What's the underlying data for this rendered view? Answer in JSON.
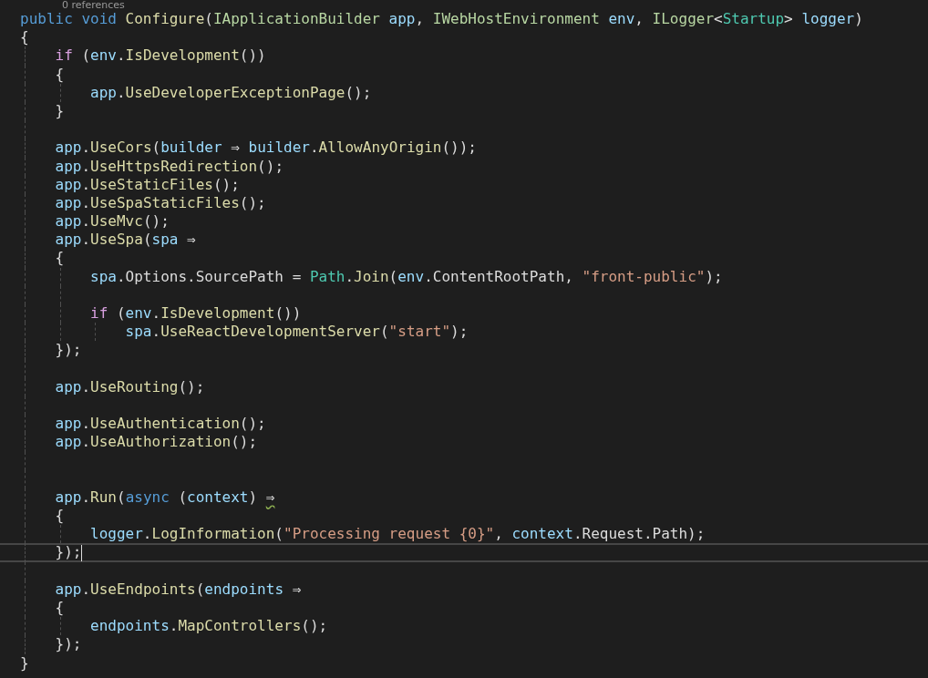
{
  "codelens": "0 references",
  "lines": [
    {
      "kind": "code",
      "tokens": [
        {
          "text": "public",
          "kind": "kw"
        },
        {
          "text": " void",
          "kind": "kw"
        },
        {
          "text": " Configure",
          "kind": "method"
        },
        {
          "text": "(",
          "kind": "plain"
        },
        {
          "text": "IApplicationBuilder",
          "kind": "iface"
        },
        {
          "text": " app",
          "kind": "var"
        },
        {
          "text": ", ",
          "kind": "plain"
        },
        {
          "text": "IWebHostEnvironment",
          "kind": "iface"
        },
        {
          "text": " env",
          "kind": "var"
        },
        {
          "text": ", ",
          "kind": "plain"
        },
        {
          "text": "ILogger",
          "kind": "iface"
        },
        {
          "text": "<",
          "kind": "plain"
        },
        {
          "text": "Startup",
          "kind": "type"
        },
        {
          "text": "> ",
          "kind": "plain"
        },
        {
          "text": "logger",
          "kind": "var"
        },
        {
          "text": ")",
          "kind": "plain"
        }
      ]
    },
    {
      "kind": "code",
      "tokens": [
        {
          "text": "{",
          "kind": "plain"
        }
      ]
    },
    {
      "kind": "code",
      "tokens": [
        {
          "text": "    if",
          "kind": "ctrl"
        },
        {
          "text": " (",
          "kind": "plain"
        },
        {
          "text": "env",
          "kind": "var"
        },
        {
          "text": ".",
          "kind": "plain"
        },
        {
          "text": "IsDevelopment",
          "kind": "method"
        },
        {
          "text": "())",
          "kind": "plain"
        }
      ]
    },
    {
      "kind": "code",
      "tokens": [
        {
          "text": "    {",
          "kind": "plain"
        }
      ]
    },
    {
      "kind": "code",
      "tokens": [
        {
          "text": "        app",
          "kind": "var"
        },
        {
          "text": ".",
          "kind": "plain"
        },
        {
          "text": "UseDeveloperExceptionPage",
          "kind": "method"
        },
        {
          "text": "();",
          "kind": "plain"
        }
      ]
    },
    {
      "kind": "code",
      "tokens": [
        {
          "text": "    }",
          "kind": "plain"
        }
      ]
    },
    {
      "kind": "blank"
    },
    {
      "kind": "code",
      "tokens": [
        {
          "text": "    app",
          "kind": "var"
        },
        {
          "text": ".",
          "kind": "plain"
        },
        {
          "text": "UseCors",
          "kind": "method"
        },
        {
          "text": "(",
          "kind": "plain"
        },
        {
          "text": "builder",
          "kind": "var"
        },
        {
          "text": " ⇒ ",
          "kind": "plain"
        },
        {
          "text": "builder",
          "kind": "var"
        },
        {
          "text": ".",
          "kind": "plain"
        },
        {
          "text": "AllowAnyOrigin",
          "kind": "method"
        },
        {
          "text": "());",
          "kind": "plain"
        }
      ]
    },
    {
      "kind": "code",
      "tokens": [
        {
          "text": "    app",
          "kind": "var"
        },
        {
          "text": ".",
          "kind": "plain"
        },
        {
          "text": "UseHttpsRedirection",
          "kind": "method"
        },
        {
          "text": "();",
          "kind": "plain"
        }
      ]
    },
    {
      "kind": "code",
      "tokens": [
        {
          "text": "    app",
          "kind": "var"
        },
        {
          "text": ".",
          "kind": "plain"
        },
        {
          "text": "UseStaticFiles",
          "kind": "method"
        },
        {
          "text": "();",
          "kind": "plain"
        }
      ]
    },
    {
      "kind": "code",
      "tokens": [
        {
          "text": "    app",
          "kind": "var"
        },
        {
          "text": ".",
          "kind": "plain"
        },
        {
          "text": "UseSpaStaticFiles",
          "kind": "method"
        },
        {
          "text": "();",
          "kind": "plain"
        }
      ]
    },
    {
      "kind": "code",
      "tokens": [
        {
          "text": "    app",
          "kind": "var"
        },
        {
          "text": ".",
          "kind": "plain"
        },
        {
          "text": "UseMvc",
          "kind": "method"
        },
        {
          "text": "();",
          "kind": "plain"
        }
      ]
    },
    {
      "kind": "code",
      "tokens": [
        {
          "text": "    app",
          "kind": "var"
        },
        {
          "text": ".",
          "kind": "plain"
        },
        {
          "text": "UseSpa",
          "kind": "method"
        },
        {
          "text": "(",
          "kind": "plain"
        },
        {
          "text": "spa",
          "kind": "var"
        },
        {
          "text": " ⇒",
          "kind": "plain"
        }
      ]
    },
    {
      "kind": "code",
      "tokens": [
        {
          "text": "    {",
          "kind": "plain"
        }
      ]
    },
    {
      "kind": "code",
      "tokens": [
        {
          "text": "        spa",
          "kind": "var"
        },
        {
          "text": ".Options.SourcePath = ",
          "kind": "plain"
        },
        {
          "text": "Path",
          "kind": "type"
        },
        {
          "text": ".",
          "kind": "plain"
        },
        {
          "text": "Join",
          "kind": "method"
        },
        {
          "text": "(",
          "kind": "plain"
        },
        {
          "text": "env",
          "kind": "var"
        },
        {
          "text": ".ContentRootPath, ",
          "kind": "plain"
        },
        {
          "text": "\"front-public\"",
          "kind": "str"
        },
        {
          "text": ");",
          "kind": "plain"
        }
      ]
    },
    {
      "kind": "blank"
    },
    {
      "kind": "code",
      "tokens": [
        {
          "text": "        if",
          "kind": "ctrl"
        },
        {
          "text": " (",
          "kind": "plain"
        },
        {
          "text": "env",
          "kind": "var"
        },
        {
          "text": ".",
          "kind": "plain"
        },
        {
          "text": "IsDevelopment",
          "kind": "method"
        },
        {
          "text": "())",
          "kind": "plain"
        }
      ]
    },
    {
      "kind": "code",
      "tokens": [
        {
          "text": "            spa",
          "kind": "var"
        },
        {
          "text": ".",
          "kind": "plain"
        },
        {
          "text": "UseReactDevelopmentServer",
          "kind": "method"
        },
        {
          "text": "(",
          "kind": "plain"
        },
        {
          "text": "\"start\"",
          "kind": "str"
        },
        {
          "text": ");",
          "kind": "plain"
        }
      ]
    },
    {
      "kind": "code",
      "tokens": [
        {
          "text": "    });",
          "kind": "plain"
        }
      ]
    },
    {
      "kind": "blank"
    },
    {
      "kind": "code",
      "tokens": [
        {
          "text": "    app",
          "kind": "var"
        },
        {
          "text": ".",
          "kind": "plain"
        },
        {
          "text": "UseRouting",
          "kind": "method"
        },
        {
          "text": "();",
          "kind": "plain"
        }
      ]
    },
    {
      "kind": "blank"
    },
    {
      "kind": "code",
      "tokens": [
        {
          "text": "    app",
          "kind": "var"
        },
        {
          "text": ".",
          "kind": "plain"
        },
        {
          "text": "UseAuthentication",
          "kind": "method"
        },
        {
          "text": "();",
          "kind": "plain"
        }
      ]
    },
    {
      "kind": "code",
      "tokens": [
        {
          "text": "    app",
          "kind": "var"
        },
        {
          "text": ".",
          "kind": "plain"
        },
        {
          "text": "UseAuthorization",
          "kind": "method"
        },
        {
          "text": "();",
          "kind": "plain"
        }
      ]
    },
    {
      "kind": "blank"
    },
    {
      "kind": "blank"
    },
    {
      "kind": "code",
      "tokens": [
        {
          "text": "    app",
          "kind": "var"
        },
        {
          "text": ".",
          "kind": "plain"
        },
        {
          "text": "Run",
          "kind": "method"
        },
        {
          "text": "(",
          "kind": "plain"
        },
        {
          "text": "async",
          "kind": "kw"
        },
        {
          "text": " (",
          "kind": "plain"
        },
        {
          "text": "context",
          "kind": "var"
        },
        {
          "text": ") ",
          "kind": "plain"
        },
        {
          "text": "⇒",
          "kind": "plain",
          "warning": true
        }
      ]
    },
    {
      "kind": "code",
      "tokens": [
        {
          "text": "    {",
          "kind": "plain"
        }
      ]
    },
    {
      "kind": "code",
      "tokens": [
        {
          "text": "        logger",
          "kind": "var"
        },
        {
          "text": ".",
          "kind": "plain"
        },
        {
          "text": "LogInformation",
          "kind": "method"
        },
        {
          "text": "(",
          "kind": "plain"
        },
        {
          "text": "\"Processing request {0}\"",
          "kind": "str"
        },
        {
          "text": ", ",
          "kind": "plain"
        },
        {
          "text": "context",
          "kind": "var"
        },
        {
          "text": ".Request.Path);",
          "kind": "plain"
        }
      ]
    },
    {
      "kind": "code",
      "tokens": [
        {
          "text": "    });",
          "kind": "plain"
        }
      ],
      "current": true
    },
    {
      "kind": "blank"
    },
    {
      "kind": "code",
      "tokens": [
        {
          "text": "    app",
          "kind": "var"
        },
        {
          "text": ".",
          "kind": "plain"
        },
        {
          "text": "UseEndpoints",
          "kind": "method"
        },
        {
          "text": "(",
          "kind": "plain"
        },
        {
          "text": "endpoints",
          "kind": "var"
        },
        {
          "text": " ⇒",
          "kind": "plain"
        }
      ]
    },
    {
      "kind": "code",
      "tokens": [
        {
          "text": "    {",
          "kind": "plain"
        }
      ]
    },
    {
      "kind": "code",
      "tokens": [
        {
          "text": "        endpoints",
          "kind": "var"
        },
        {
          "text": ".",
          "kind": "plain"
        },
        {
          "text": "MapControllers",
          "kind": "method"
        },
        {
          "text": "();",
          "kind": "plain"
        }
      ]
    },
    {
      "kind": "code",
      "tokens": [
        {
          "text": "    });",
          "kind": "plain"
        }
      ]
    },
    {
      "kind": "code",
      "tokens": [
        {
          "text": "}",
          "kind": "plain"
        }
      ]
    }
  ]
}
